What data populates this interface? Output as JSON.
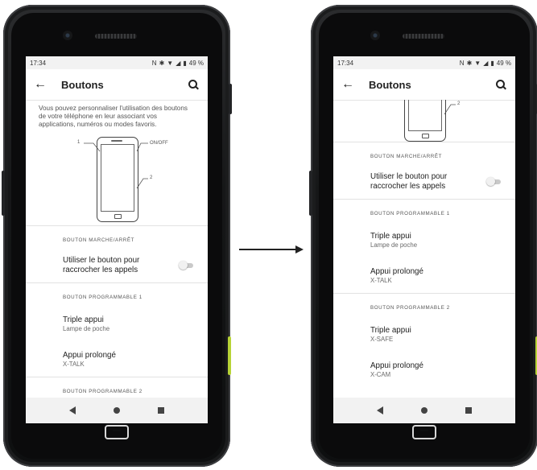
{
  "left": {
    "status": {
      "time": "17:34",
      "battery": "49 %"
    },
    "title": "Boutons",
    "description": "Vous pouvez personnaliser l'utilisation des boutons de votre téléphone en leur associant vos applications, numéros ou modes favoris.",
    "diagram": {
      "label_1": "1",
      "label_onoff": "ON/OFF",
      "label_2": "2"
    },
    "section1": "BOUTON MARCHE/ARRÊT",
    "toggle_label_line1": "Utiliser le bouton pour",
    "toggle_label_line2": "raccrocher les appels",
    "section2": "BOUTON PROGRAMMABLE 1",
    "item1_title": "Triple appui",
    "item1_sub": "Lampe de poche",
    "item2_title": "Appui prolongé",
    "item2_sub": "X-TALK",
    "section3": "BOUTON PROGRAMMABLE 2"
  },
  "right": {
    "status": {
      "time": "17:34",
      "battery": "49 %"
    },
    "title": "Boutons",
    "diagram": {
      "label_2": "2"
    },
    "section1": "BOUTON MARCHE/ARRÊT",
    "toggle_label_line1": "Utiliser le bouton pour",
    "toggle_label_line2": "raccrocher les appels",
    "section2": "BOUTON PROGRAMMABLE 1",
    "item1_title": "Triple appui",
    "item1_sub": "Lampe de poche",
    "item2_title": "Appui prolongé",
    "item2_sub": "X-TALK",
    "section3": "BOUTON PROGRAMMABLE 2",
    "item3_title": "Triple appui",
    "item3_sub": "X-SAFE",
    "item4_title": "Appui prolongé",
    "item4_sub": "X-CAM"
  },
  "toggle_state": false,
  "icons": {
    "back": "arrow-left-icon",
    "search": "search-icon",
    "nav_back": "triangle-back-icon",
    "nav_home": "circle-home-icon",
    "nav_recent": "square-recent-icon"
  }
}
